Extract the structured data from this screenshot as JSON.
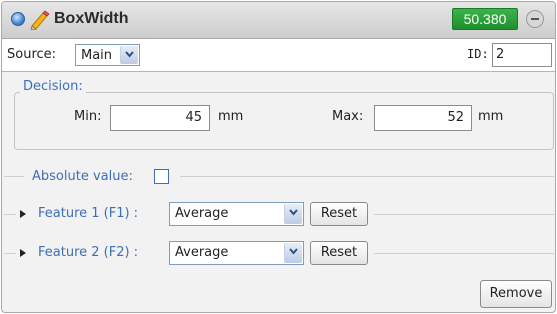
{
  "header": {
    "title": "BoxWidth",
    "value": "50.380",
    "status_icon": "status-dot-icon",
    "edit_icon": "pencil-icon",
    "close_icon": "close-icon"
  },
  "source": {
    "label": "Source:",
    "selected": "Main",
    "id_label": "ID:",
    "id_value": "2"
  },
  "decision": {
    "legend": "Decision:",
    "min_label": "Min:",
    "min_value": "45",
    "min_unit": "mm",
    "max_label": "Max:",
    "max_value": "52",
    "max_unit": "mm"
  },
  "absolute": {
    "label": "Absolute value:",
    "checked": false
  },
  "features": [
    {
      "label": "Feature 1 (F1) :",
      "selected": "Average",
      "reset_label": "Reset"
    },
    {
      "label": "Feature 2 (F2) :",
      "selected": "Average",
      "reset_label": "Reset"
    }
  ],
  "footer": {
    "remove_label": "Remove"
  },
  "colors": {
    "accent": "#3d6fb6",
    "badge": "#2aa33a"
  }
}
